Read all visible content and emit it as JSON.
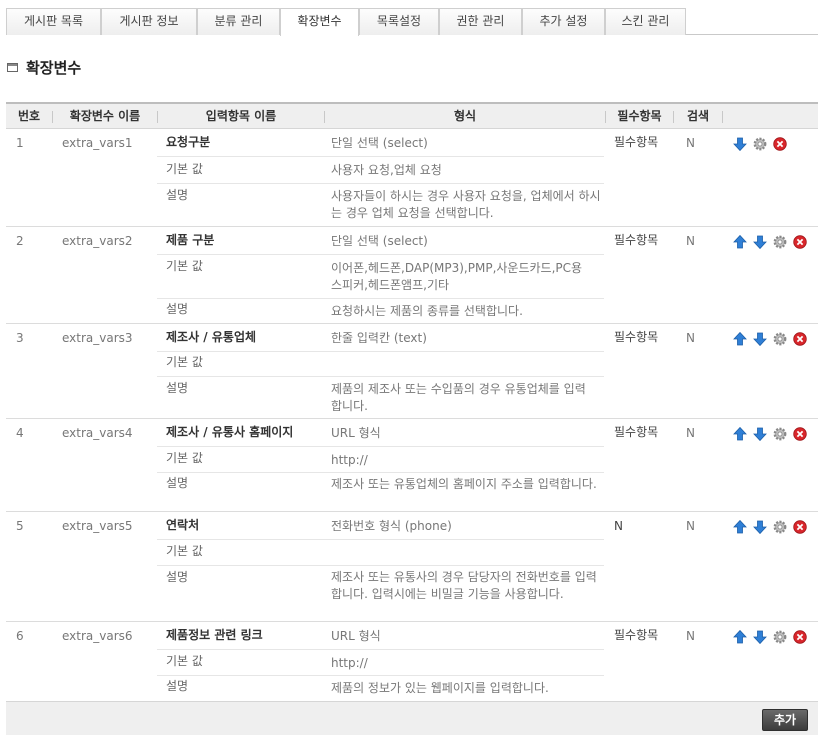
{
  "tabs": [
    {
      "label": "게시판 목록"
    },
    {
      "label": "게시판 정보"
    },
    {
      "label": "분류 관리"
    },
    {
      "label": "확장변수"
    },
    {
      "label": "목록설정"
    },
    {
      "label": "권한 관리"
    },
    {
      "label": "추가 설정"
    },
    {
      "label": "스킨 관리"
    }
  ],
  "active_tab": "확장변수",
  "page_title": "확장변수",
  "columns": {
    "no": "번호",
    "var": "확장변수 이름",
    "name": "입력항목 이름",
    "format": "형식",
    "required": "필수항목",
    "search": "검색"
  },
  "labels": {
    "default": "기본 값",
    "desc": "설명"
  },
  "rows": [
    {
      "no": "1",
      "var": "extra_vars1",
      "name": "요청구분",
      "type": "단일 선택 (select)",
      "default": "사용자 요청,업체 요청",
      "desc": "사용자들이 하시는 경우 사용자 요청을, 업체에서 하시는 경우 업체 요청을 선택합니다.",
      "required": "필수항목",
      "search": "N"
    },
    {
      "no": "2",
      "var": "extra_vars2",
      "name": "제품 구분",
      "type": "단일 선택 (select)",
      "default": "이어폰,헤드폰,DAP(MP3),PMP,사운드카드,PC용 스피커,헤드폰앰프,기타",
      "desc": "요청하시는 제품의 종류를 선택합니다.",
      "required": "필수항목",
      "search": "N"
    },
    {
      "no": "3",
      "var": "extra_vars3",
      "name": "제조사 / 유통업체",
      "type": "한줄 입력칸 (text)",
      "default": "",
      "desc": "제품의 제조사 또는 수입품의 경우 유통업체를 입력합니다.",
      "required": "필수항목",
      "search": "N"
    },
    {
      "no": "4",
      "var": "extra_vars4",
      "name": "제조사 / 유통사 홈페이지",
      "type": "URL 형식",
      "default": "http://",
      "desc": "제조사 또는 유통업체의 홈페이지 주소를 입력합니다.",
      "required": "필수항목",
      "search": "N"
    },
    {
      "no": "5",
      "var": "extra_vars5",
      "name": "연락처",
      "type": "전화번호 형식 (phone)",
      "default": "",
      "desc": "제조사 또는 유통사의 경우 담당자의 전화번호를 입력합니다. 입력시에는 비밀글 기능을 사용합니다.",
      "required": "N",
      "search": "N"
    },
    {
      "no": "6",
      "var": "extra_vars6",
      "name": "제품정보 관련 링크",
      "type": "URL 형식",
      "default": "http://",
      "desc": "제품의 정보가 있는 웹페이지를 입력합니다.",
      "required": "필수항목",
      "search": "N"
    }
  ],
  "add_button": "추가"
}
